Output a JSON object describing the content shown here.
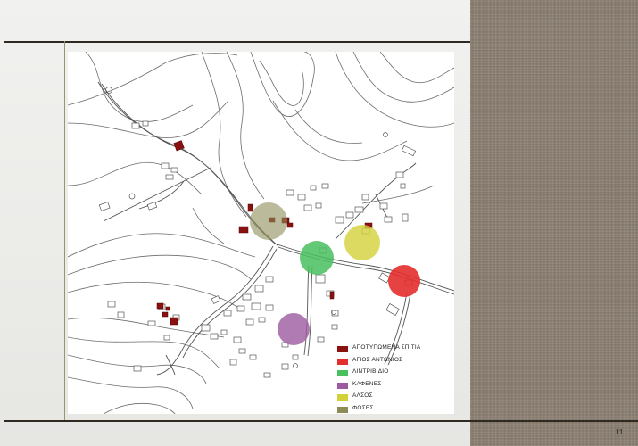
{
  "legend": [
    {
      "label": "ΑΠΟΤΥΠΩΜΕΝΑ ΣΠΙΤΙΑ",
      "color": "#8b1010"
    },
    {
      "label": "ΑΓΙΟΣ ΑΝΤΩΝΙΟΣ",
      "color": "#e42d2d"
    },
    {
      "label": "ΛΙΝΤΡΙΒΙΔΙΟ",
      "color": "#49c05e"
    },
    {
      "label": "ΚΑΦΕΝΕΣ",
      "color": "#9c5aa0"
    },
    {
      "label": "ΑΛΣΟΣ",
      "color": "#d3d13a"
    },
    {
      "label": "ΦΟΣΕΣ",
      "color": "#8d8c58"
    }
  ],
  "page_number": "11",
  "map": {
    "icons": [
      "building-footprint",
      "road-line",
      "contour-line",
      "highlight-circle"
    ]
  }
}
